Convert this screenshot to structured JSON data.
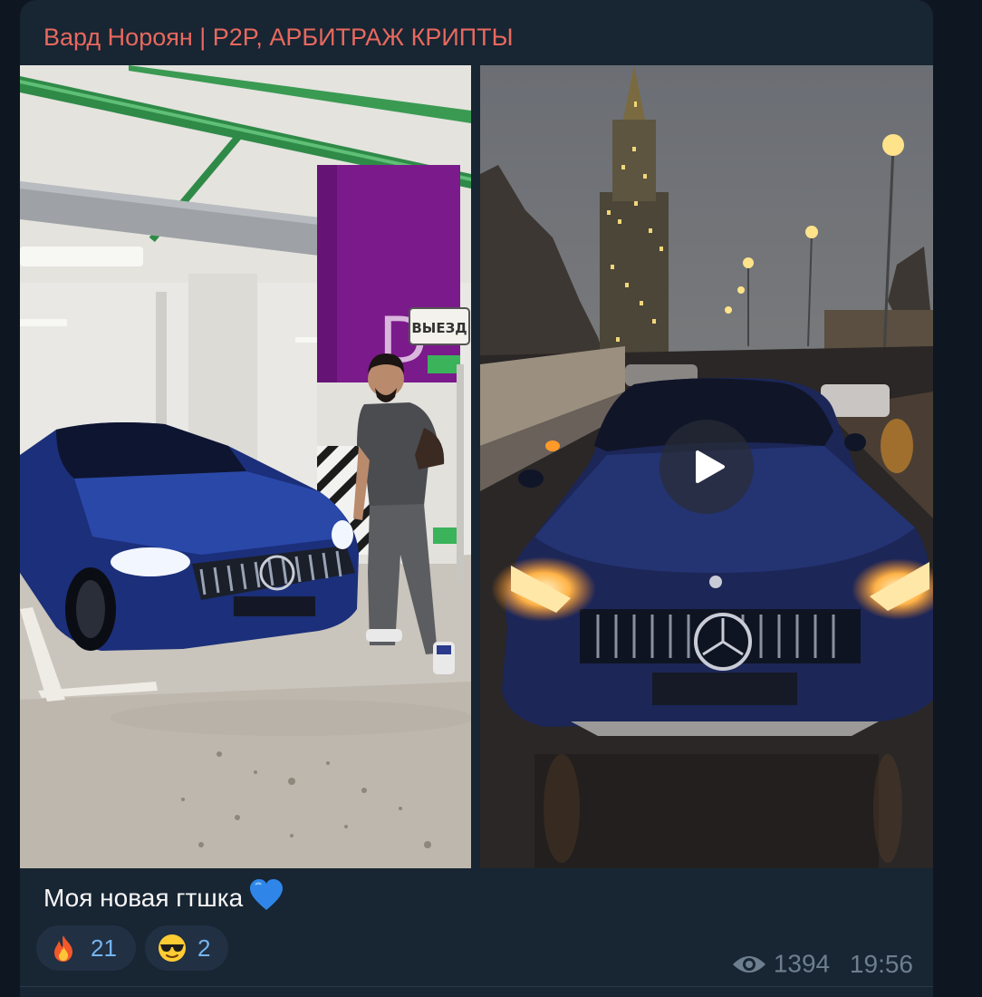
{
  "message": {
    "sender": "Вард Нороян | P2P, АРБИТРАЖ КРИПТЫ",
    "caption": "Моя новая гтшка",
    "caption_emoji_icon": "blue-heart-icon",
    "photo_signs": {
      "exit_sign": "ВЫЕЗД",
      "level_letter": "D"
    },
    "reactions": [
      {
        "icon": "fire-icon",
        "count": "21"
      },
      {
        "icon": "sunglasses-face-icon",
        "count": "2"
      }
    ],
    "views": "1394",
    "time": "19:56"
  },
  "colors": {
    "background": "#0e1621",
    "bubble": "#182533",
    "sender_name": "#e8695e",
    "reaction_count": "#76b5f0",
    "meta": "#6d7f8f"
  }
}
